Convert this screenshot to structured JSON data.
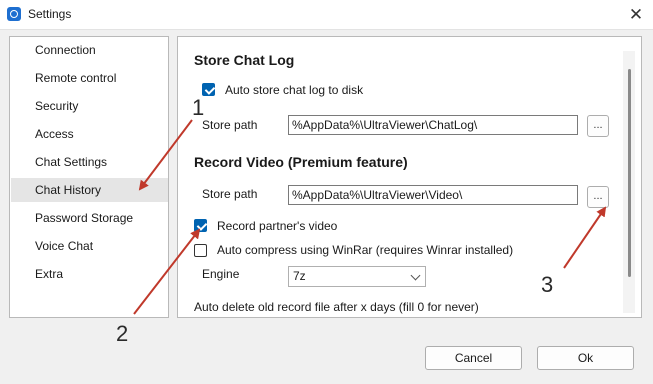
{
  "window": {
    "title": "Settings"
  },
  "sidebar": {
    "items": [
      {
        "label": "Connection"
      },
      {
        "label": "Remote control"
      },
      {
        "label": "Security"
      },
      {
        "label": "Access"
      },
      {
        "label": "Chat Settings"
      },
      {
        "label": "Chat History",
        "selected": true
      },
      {
        "label": "Password Storage"
      },
      {
        "label": "Voice Chat"
      },
      {
        "label": "Extra"
      }
    ]
  },
  "chat_log": {
    "title": "Store Chat Log",
    "auto_store_label": "Auto store chat log to disk",
    "auto_store_checked": true,
    "store_path_label": "Store path",
    "store_path_value": "%AppData%\\UltraViewer\\ChatLog\\",
    "browse_label": "..."
  },
  "record_video": {
    "title": "Record Video (Premium feature)",
    "store_path_label": "Store path",
    "store_path_value": "%AppData%\\UltraViewer\\Video\\",
    "browse_label": "...",
    "record_partner_label": "Record partner's video",
    "record_partner_checked": true,
    "auto_compress_label": "Auto compress using WinRar (requires Winrar installed)",
    "auto_compress_checked": false,
    "engine_label": "Engine",
    "engine_value": "7z",
    "auto_delete_label": "Auto delete old record file after x days (fill 0 for never)"
  },
  "footer": {
    "cancel_label": "Cancel",
    "ok_label": "Ok"
  },
  "annotations": {
    "n1": "1",
    "n2": "2",
    "n3": "3",
    "arrow_color": "#c0392b"
  }
}
